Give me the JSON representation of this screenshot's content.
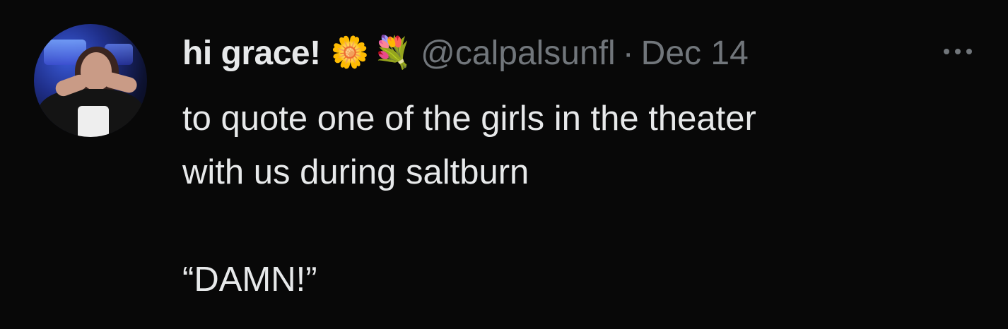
{
  "tweet": {
    "display_name": "hi grace!",
    "emoji_1": "🌼",
    "emoji_2": "💐",
    "handle": "@calpalsunfl",
    "separator": "·",
    "date": "Dec 14",
    "body_lines": [
      "to quote one of the girls in the theater",
      "with us during saltburn",
      "“DAMN!”"
    ]
  },
  "icons": {
    "more": "more-horizontal-icon",
    "avatar": "profile-avatar"
  },
  "colors": {
    "background": "#080808",
    "primary_text": "#e7e9ea",
    "secondary_text": "#71767b"
  }
}
